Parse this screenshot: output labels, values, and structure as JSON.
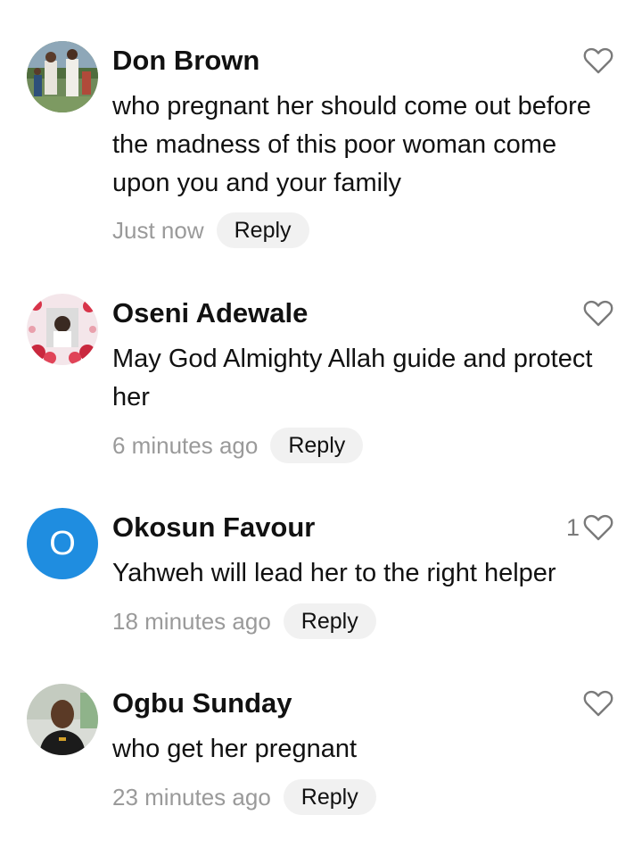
{
  "comments": [
    {
      "name": "Don Brown",
      "text": "who pregnant her should come out before the madness of this poor woman come upon you and your family",
      "time": "Just now",
      "reply_label": "Reply",
      "likes": ""
    },
    {
      "name": "Oseni Adewale",
      "text": "May God Almighty Allah guide and protect her",
      "time": "6 minutes ago",
      "reply_label": "Reply",
      "likes": ""
    },
    {
      "name": "Okosun Favour",
      "avatar_letter": "O",
      "text": "Yahweh will lead her to the right helper",
      "time": "18 minutes ago",
      "reply_label": "Reply",
      "likes": "1"
    },
    {
      "name": "Ogbu Sunday",
      "text": "who get her pregnant",
      "time": "23 minutes ago",
      "reply_label": "Reply",
      "likes": ""
    }
  ],
  "colors": {
    "avatar_blue": "#1f8de0",
    "reply_bg": "#f1f1f1",
    "meta_gray": "#9a9a9a"
  },
  "icons": {
    "like": "heart-outline-icon"
  }
}
